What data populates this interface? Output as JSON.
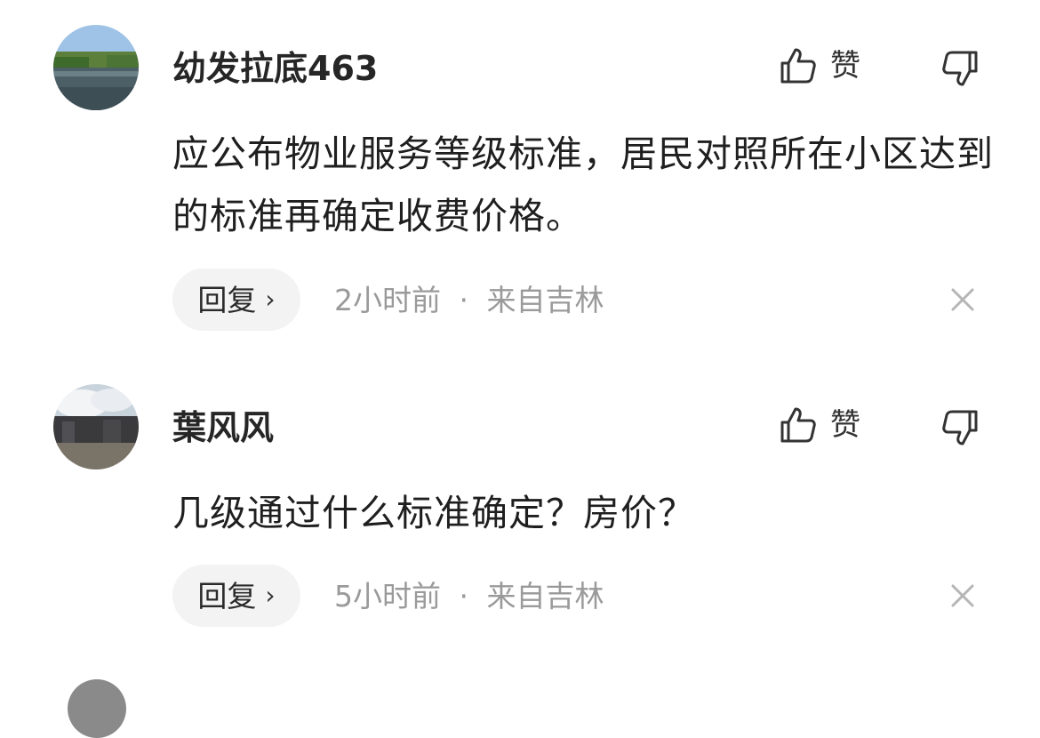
{
  "comments": [
    {
      "username": "幼发拉底463",
      "like_label": "赞",
      "text": "应公布物业服务等级标准，居民对照所在小区达到的标准再确定收费价格。",
      "reply_label": "回复",
      "reply_arrow": "›",
      "time": "2小时前",
      "separator": "·",
      "location": "来自吉林",
      "avatar_icon": "river-landscape-avatar",
      "like_icon": "thumbs-up-icon",
      "dislike_icon": "thumbs-down-icon",
      "close_icon": "close-icon"
    },
    {
      "username": "葉风风",
      "like_label": "赞",
      "text": "几级通过什么标准确定？房价？",
      "reply_label": "回复",
      "reply_arrow": "›",
      "time": "5小时前",
      "separator": "·",
      "location": "来自吉林",
      "avatar_icon": "cloudy-city-avatar",
      "like_icon": "thumbs-up-icon",
      "dislike_icon": "thumbs-down-icon",
      "close_icon": "close-icon"
    }
  ],
  "colors": {
    "username": "#262626",
    "body_text": "#1f1f1f",
    "meta_text": "#9a9a9a",
    "reply_pill_bg": "#f3f3f3",
    "icon_stroke": "#333333",
    "close_icon": "#b5b5b5"
  }
}
